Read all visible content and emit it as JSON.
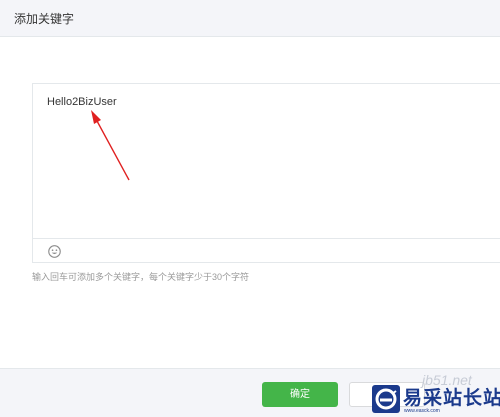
{
  "dialog": {
    "title": "添加关键字"
  },
  "editor": {
    "value": "Hello2BizUser",
    "emoji_icon": "smiley-face-icon"
  },
  "hint": "输入回车可添加多个关键字，每个关键字少于30个字符",
  "footer": {
    "confirm_label": "确定",
    "cancel_label": ""
  },
  "annotation": {
    "color": "#e02020"
  },
  "watermark": {
    "faint_text": "jb51.net",
    "brand_text": "易采站长站",
    "url_text": "www.easck.com"
  },
  "colors": {
    "accent_green": "#44b549",
    "header_bg": "#f4f5f9",
    "border": "#e4e8eb"
  }
}
